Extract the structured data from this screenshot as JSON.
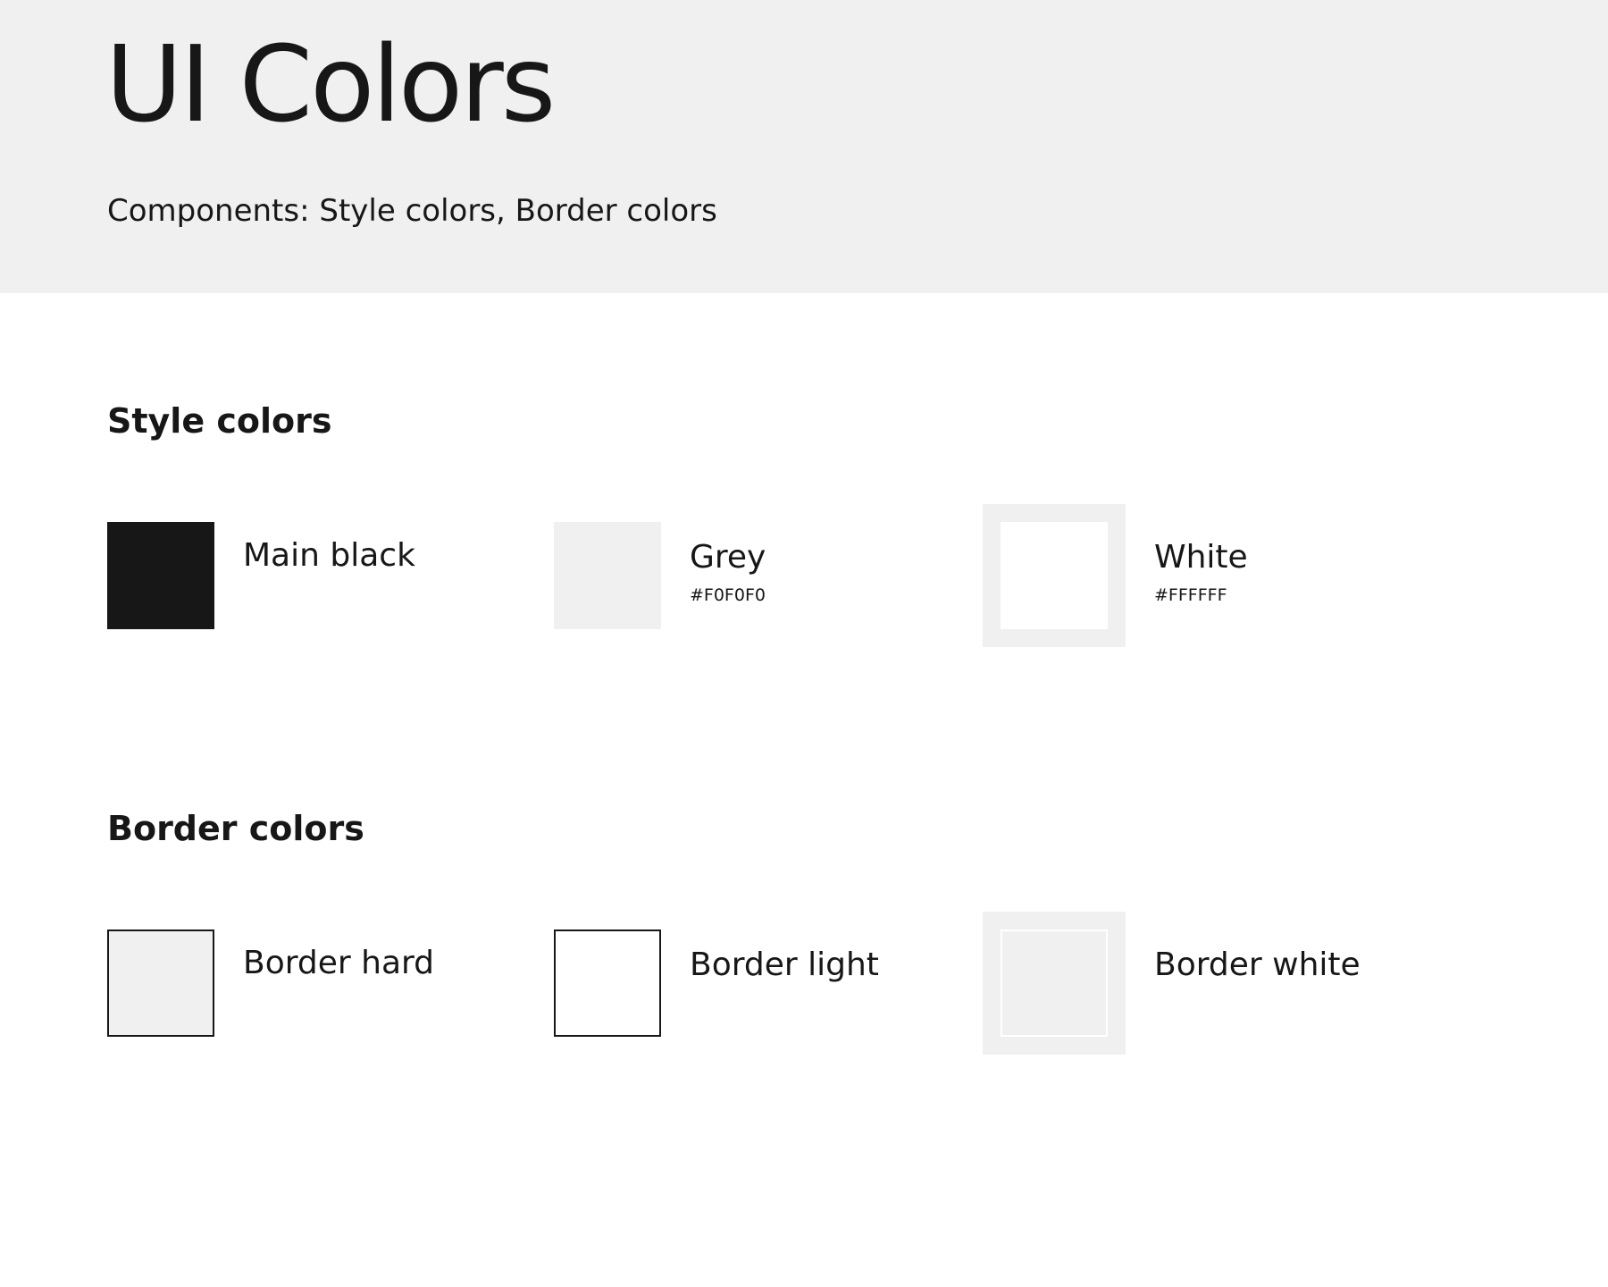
{
  "header": {
    "title": "UI Colors",
    "subtitle": "Components: Style colors, Border colors"
  },
  "style_colors": {
    "title": "Style colors",
    "items": [
      {
        "label": "Main black",
        "color": "#171717"
      },
      {
        "label": "Grey",
        "hex": "#F0F0F0",
        "color": "#F0F0F0"
      },
      {
        "label": "White",
        "hex": "#FFFFFF",
        "color": "#FFFFFF"
      }
    ]
  },
  "border_colors": {
    "title": "Border colors",
    "items": [
      {
        "label": "Border hard",
        "fill": "#F0F0F0",
        "border": "#171717"
      },
      {
        "label": "Border light",
        "fill": "#FFFFFF",
        "border": "#171717"
      },
      {
        "label": "Border white",
        "fill": "#F0F0F0",
        "border": "#FFFFFF"
      }
    ]
  }
}
